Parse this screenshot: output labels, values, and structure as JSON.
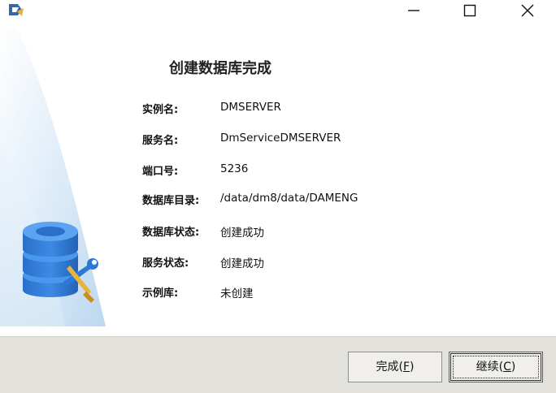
{
  "window": {
    "icon": "dm-installer-icon",
    "controls": {
      "minimize": "minimize-icon",
      "maximize": "maximize-icon",
      "close": "close-icon"
    }
  },
  "page": {
    "title": "创建数据库完成"
  },
  "info": [
    {
      "label": "实例名:",
      "value": "DMSERVER"
    },
    {
      "label": "服务名:",
      "value": "DmServiceDMSERVER"
    },
    {
      "label": "端口号:",
      "value": "5236"
    },
    {
      "label": "数据库目录:",
      "value": "/data/dm8/data/DAMENG"
    },
    {
      "label": "数据库状态:",
      "value": "创建成功"
    },
    {
      "label": "服务状态:",
      "value": "创建成功"
    },
    {
      "label": "示例库:",
      "value": "未创建"
    }
  ],
  "footer": {
    "finish": {
      "text": "完成(",
      "mnemonic": "F",
      "suffix": ")"
    },
    "continue": {
      "text": "继续(",
      "mnemonic": "C",
      "suffix": ")"
    }
  },
  "colors": {
    "accent_blue": "#2f7fd6",
    "footer_bg": "#e3e1dc",
    "deco_blue": "#cfe4f5"
  }
}
